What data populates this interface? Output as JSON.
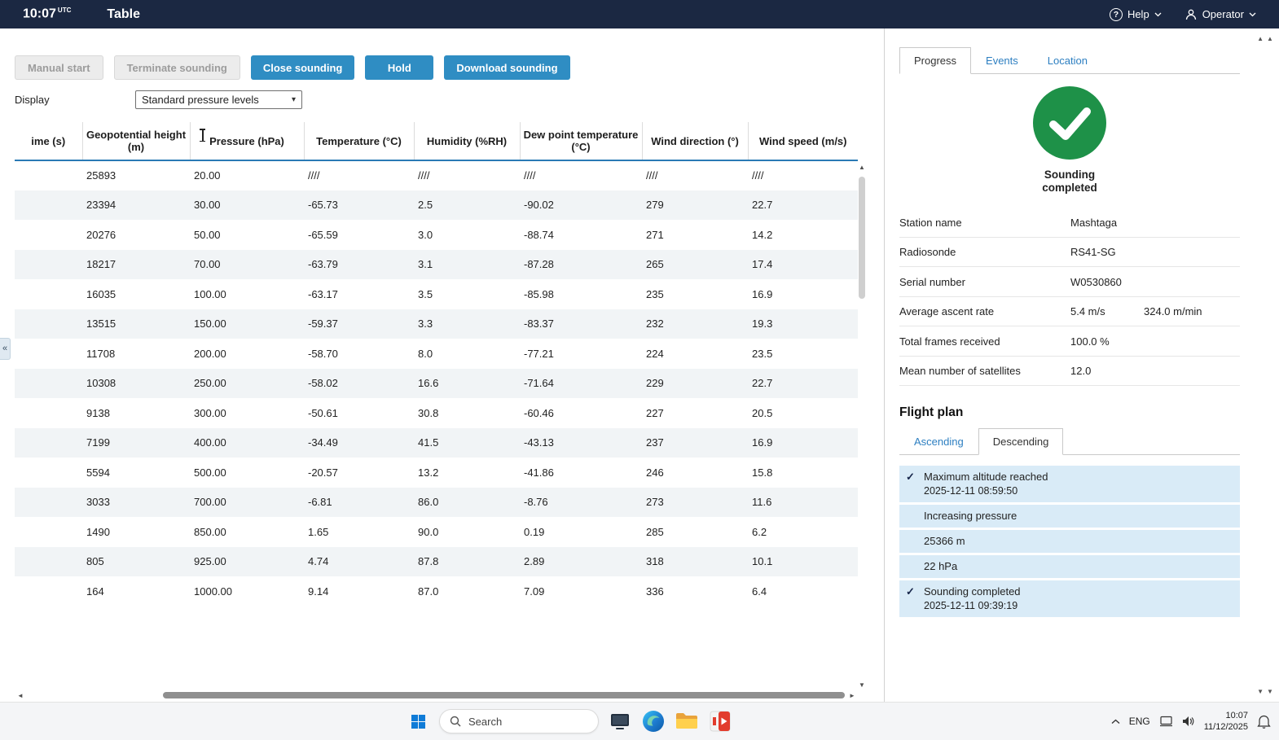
{
  "colors": {
    "topbar-bg": "#1b2842",
    "accent": "#2f8dc3",
    "header-underline": "#2a7ab5",
    "success-green": "#1e9148",
    "row-alt": "#f1f4f6",
    "event-bg": "#d9ebf7",
    "link-blue": "#2d7fc1"
  },
  "icons": {
    "collapse": "«",
    "up-arrow": "▲",
    "down-arrow": "▼",
    "left-arrow": "◄",
    "right-arrow": "►",
    "check": "✓",
    "chevron-down": "▾",
    "help": "?"
  },
  "topbar": {
    "time": "10:07",
    "time_suffix": "UTC",
    "title": "Table",
    "help": "Help",
    "operator": "Operator"
  },
  "toolbar": {
    "buttons": [
      {
        "name": "manual-start-button",
        "label": "Manual start",
        "enabled": false
      },
      {
        "name": "terminate-sounding-button",
        "label": "Terminate sounding",
        "enabled": false
      },
      {
        "name": "close-sounding-button",
        "label": "Close sounding",
        "enabled": true
      },
      {
        "name": "hold-button",
        "label": "Hold",
        "enabled": true
      },
      {
        "name": "download-sounding-button",
        "label": "Download sounding",
        "enabled": true
      }
    ],
    "display_label": "Display",
    "display_value": "Standard pressure levels"
  },
  "table": {
    "columns": [
      "ime (s)",
      "Geopotential height (m)",
      "Pressure (hPa)",
      "Temperature (°C)",
      "Humidity (%RH)",
      "Dew point temperature (°C)",
      "Wind direction (°)",
      "Wind speed (m/s)"
    ],
    "rows": [
      [
        "",
        "25893",
        "20.00",
        "////",
        "////",
        "////",
        "////",
        "////"
      ],
      [
        "",
        "23394",
        "30.00",
        "-65.73",
        "2.5",
        "-90.02",
        "279",
        "22.7"
      ],
      [
        "",
        "20276",
        "50.00",
        "-65.59",
        "3.0",
        "-88.74",
        "271",
        "14.2"
      ],
      [
        "",
        "18217",
        "70.00",
        "-63.79",
        "3.1",
        "-87.28",
        "265",
        "17.4"
      ],
      [
        "",
        "16035",
        "100.00",
        "-63.17",
        "3.5",
        "-85.98",
        "235",
        "16.9"
      ],
      [
        "",
        "13515",
        "150.00",
        "-59.37",
        "3.3",
        "-83.37",
        "232",
        "19.3"
      ],
      [
        "",
        "11708",
        "200.00",
        "-58.70",
        "8.0",
        "-77.21",
        "224",
        "23.5"
      ],
      [
        "",
        "10308",
        "250.00",
        "-58.02",
        "16.6",
        "-71.64",
        "229",
        "22.7"
      ],
      [
        "",
        "9138",
        "300.00",
        "-50.61",
        "30.8",
        "-60.46",
        "227",
        "20.5"
      ],
      [
        "",
        "7199",
        "400.00",
        "-34.49",
        "41.5",
        "-43.13",
        "237",
        "16.9"
      ],
      [
        "",
        "5594",
        "500.00",
        "-20.57",
        "13.2",
        "-41.86",
        "246",
        "15.8"
      ],
      [
        "",
        "3033",
        "700.00",
        "-6.81",
        "86.0",
        "-8.76",
        "273",
        "11.6"
      ],
      [
        "",
        "1490",
        "850.00",
        "1.65",
        "90.0",
        "0.19",
        "285",
        "6.2"
      ],
      [
        "",
        "805",
        "925.00",
        "4.74",
        "87.8",
        "2.89",
        "318",
        "10.1"
      ],
      [
        "",
        "164",
        "1000.00",
        "9.14",
        "87.0",
        "7.09",
        "336",
        "6.4"
      ]
    ]
  },
  "panel": {
    "tabs": [
      {
        "name": "tab-progress",
        "label": "Progress",
        "active": true
      },
      {
        "name": "tab-events",
        "label": "Events",
        "active": false
      },
      {
        "name": "tab-location",
        "label": "Location",
        "active": false
      }
    ],
    "status_text": "Sounding completed",
    "details": [
      {
        "label": "Station name",
        "value": "Mashtaga",
        "value2": ""
      },
      {
        "label": "Radiosonde",
        "value": "RS41-SG",
        "value2": ""
      },
      {
        "label": "Serial number",
        "value": "W0530860",
        "value2": ""
      },
      {
        "label": "Average ascent rate",
        "value": "5.4 m/s",
        "value2": "324.0 m/min"
      },
      {
        "label": "Total frames received",
        "value": "100.0 %",
        "value2": ""
      },
      {
        "label": "Mean number of satellites",
        "value": "12.0",
        "value2": ""
      }
    ],
    "flight_plan_title": "Flight plan",
    "flight_tabs": [
      {
        "name": "tab-ascending",
        "label": "Ascending",
        "active": false
      },
      {
        "name": "tab-descending",
        "label": "Descending",
        "active": true
      }
    ],
    "events": [
      {
        "checked": true,
        "title": "Maximum altitude reached",
        "timestamp": "2025-12-11 08:59:50"
      },
      {
        "checked": false,
        "title": "Increasing pressure",
        "timestamp": ""
      },
      {
        "checked": false,
        "title": "25366 m",
        "timestamp": ""
      },
      {
        "checked": false,
        "title": "22 hPa",
        "timestamp": ""
      },
      {
        "checked": true,
        "title": "Sounding completed",
        "timestamp": "2025-12-11 09:39:19"
      }
    ]
  },
  "taskbar": {
    "search_placeholder": "Search",
    "language": "ENG",
    "time": "10:07",
    "date": "11/12/2025"
  }
}
